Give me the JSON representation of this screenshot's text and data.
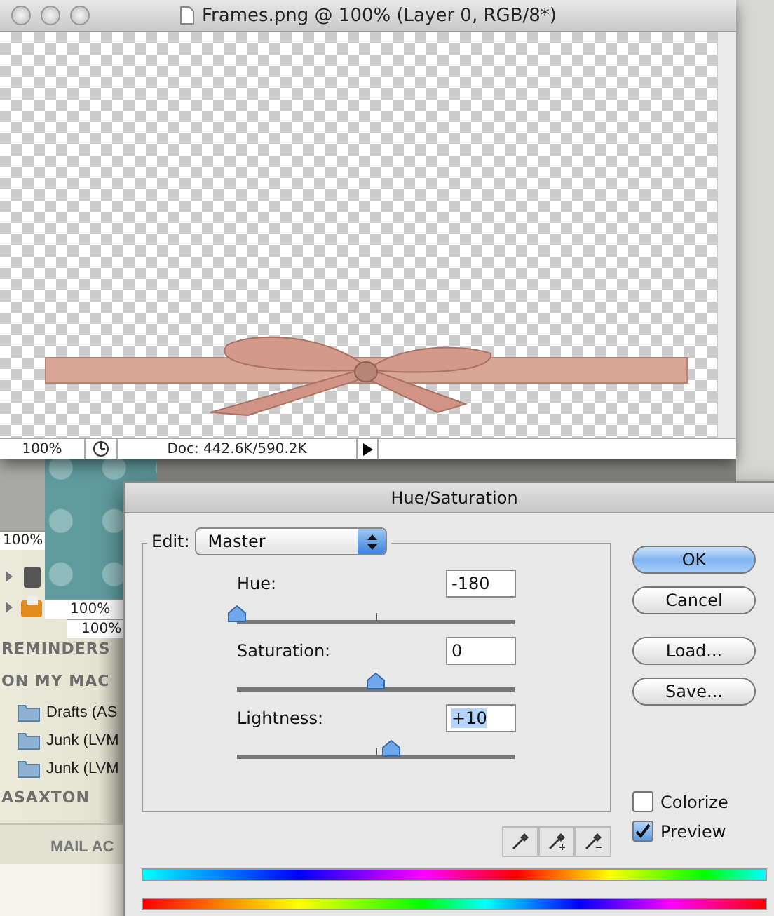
{
  "document_window": {
    "title": "Frames.png @ 100% (Layer 0, RGB/8*)",
    "zoom": "100%",
    "doc_info": "Doc: 442.6K/590.2K"
  },
  "background_windows": [
    {
      "zoom": "100%"
    },
    {
      "zoom": "100%"
    },
    {
      "zoom": "100%"
    }
  ],
  "mail_sidebar": {
    "sections": [
      {
        "heading": "REMINDERS"
      },
      {
        "heading": "ON MY MAC",
        "items": [
          "Drafts (AS",
          "Junk (LVM",
          "Junk (LVM"
        ]
      },
      {
        "heading": "ASAXTON"
      }
    ],
    "footer": "MAIL AC"
  },
  "dialog": {
    "title": "Hue/Saturation",
    "edit_label": "Edit:",
    "edit_value": "Master",
    "sliders": [
      {
        "label": "Hue:",
        "value": "-180",
        "level": 0,
        "highlighted": false
      },
      {
        "label": "Saturation:",
        "value": "0",
        "level": 0.5,
        "highlighted": false
      },
      {
        "label": "Lightness:",
        "value": "+10",
        "level": 0.555,
        "highlighted": true
      }
    ],
    "buttons": [
      {
        "label": "OK",
        "default": true
      },
      {
        "label": "Cancel",
        "default": false
      },
      {
        "label": "Load...",
        "default": false
      },
      {
        "label": "Save...",
        "default": false
      }
    ],
    "checkboxes": [
      {
        "label": "Colorize",
        "checked": false
      },
      {
        "label": "Preview",
        "checked": true
      }
    ]
  }
}
